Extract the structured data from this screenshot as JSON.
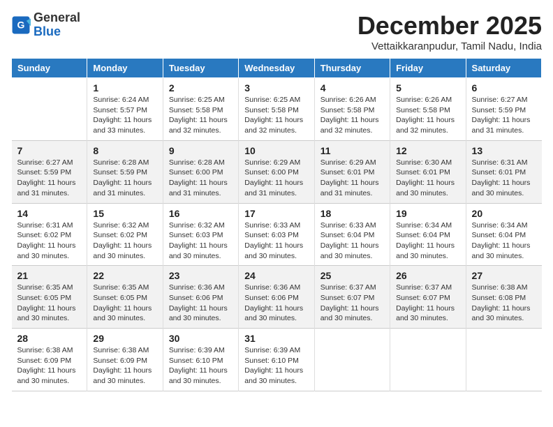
{
  "logo": {
    "general": "General",
    "blue": "Blue"
  },
  "header": {
    "month": "December 2025",
    "location": "Vettaikkaranpudur, Tamil Nadu, India"
  },
  "days_of_week": [
    "Sunday",
    "Monday",
    "Tuesday",
    "Wednesday",
    "Thursday",
    "Friday",
    "Saturday"
  ],
  "weeks": [
    [
      {
        "day": "",
        "info": ""
      },
      {
        "day": "1",
        "info": "Sunrise: 6:24 AM\nSunset: 5:57 PM\nDaylight: 11 hours\nand 33 minutes."
      },
      {
        "day": "2",
        "info": "Sunrise: 6:25 AM\nSunset: 5:58 PM\nDaylight: 11 hours\nand 32 minutes."
      },
      {
        "day": "3",
        "info": "Sunrise: 6:25 AM\nSunset: 5:58 PM\nDaylight: 11 hours\nand 32 minutes."
      },
      {
        "day": "4",
        "info": "Sunrise: 6:26 AM\nSunset: 5:58 PM\nDaylight: 11 hours\nand 32 minutes."
      },
      {
        "day": "5",
        "info": "Sunrise: 6:26 AM\nSunset: 5:58 PM\nDaylight: 11 hours\nand 32 minutes."
      },
      {
        "day": "6",
        "info": "Sunrise: 6:27 AM\nSunset: 5:59 PM\nDaylight: 11 hours\nand 31 minutes."
      }
    ],
    [
      {
        "day": "7",
        "info": "Sunrise: 6:27 AM\nSunset: 5:59 PM\nDaylight: 11 hours\nand 31 minutes."
      },
      {
        "day": "8",
        "info": "Sunrise: 6:28 AM\nSunset: 5:59 PM\nDaylight: 11 hours\nand 31 minutes."
      },
      {
        "day": "9",
        "info": "Sunrise: 6:28 AM\nSunset: 6:00 PM\nDaylight: 11 hours\nand 31 minutes."
      },
      {
        "day": "10",
        "info": "Sunrise: 6:29 AM\nSunset: 6:00 PM\nDaylight: 11 hours\nand 31 minutes."
      },
      {
        "day": "11",
        "info": "Sunrise: 6:29 AM\nSunset: 6:01 PM\nDaylight: 11 hours\nand 31 minutes."
      },
      {
        "day": "12",
        "info": "Sunrise: 6:30 AM\nSunset: 6:01 PM\nDaylight: 11 hours\nand 30 minutes."
      },
      {
        "day": "13",
        "info": "Sunrise: 6:31 AM\nSunset: 6:01 PM\nDaylight: 11 hours\nand 30 minutes."
      }
    ],
    [
      {
        "day": "14",
        "info": "Sunrise: 6:31 AM\nSunset: 6:02 PM\nDaylight: 11 hours\nand 30 minutes."
      },
      {
        "day": "15",
        "info": "Sunrise: 6:32 AM\nSunset: 6:02 PM\nDaylight: 11 hours\nand 30 minutes."
      },
      {
        "day": "16",
        "info": "Sunrise: 6:32 AM\nSunset: 6:03 PM\nDaylight: 11 hours\nand 30 minutes."
      },
      {
        "day": "17",
        "info": "Sunrise: 6:33 AM\nSunset: 6:03 PM\nDaylight: 11 hours\nand 30 minutes."
      },
      {
        "day": "18",
        "info": "Sunrise: 6:33 AM\nSunset: 6:04 PM\nDaylight: 11 hours\nand 30 minutes."
      },
      {
        "day": "19",
        "info": "Sunrise: 6:34 AM\nSunset: 6:04 PM\nDaylight: 11 hours\nand 30 minutes."
      },
      {
        "day": "20",
        "info": "Sunrise: 6:34 AM\nSunset: 6:04 PM\nDaylight: 11 hours\nand 30 minutes."
      }
    ],
    [
      {
        "day": "21",
        "info": "Sunrise: 6:35 AM\nSunset: 6:05 PM\nDaylight: 11 hours\nand 30 minutes."
      },
      {
        "day": "22",
        "info": "Sunrise: 6:35 AM\nSunset: 6:05 PM\nDaylight: 11 hours\nand 30 minutes."
      },
      {
        "day": "23",
        "info": "Sunrise: 6:36 AM\nSunset: 6:06 PM\nDaylight: 11 hours\nand 30 minutes."
      },
      {
        "day": "24",
        "info": "Sunrise: 6:36 AM\nSunset: 6:06 PM\nDaylight: 11 hours\nand 30 minutes."
      },
      {
        "day": "25",
        "info": "Sunrise: 6:37 AM\nSunset: 6:07 PM\nDaylight: 11 hours\nand 30 minutes."
      },
      {
        "day": "26",
        "info": "Sunrise: 6:37 AM\nSunset: 6:07 PM\nDaylight: 11 hours\nand 30 minutes."
      },
      {
        "day": "27",
        "info": "Sunrise: 6:38 AM\nSunset: 6:08 PM\nDaylight: 11 hours\nand 30 minutes."
      }
    ],
    [
      {
        "day": "28",
        "info": "Sunrise: 6:38 AM\nSunset: 6:09 PM\nDaylight: 11 hours\nand 30 minutes."
      },
      {
        "day": "29",
        "info": "Sunrise: 6:38 AM\nSunset: 6:09 PM\nDaylight: 11 hours\nand 30 minutes."
      },
      {
        "day": "30",
        "info": "Sunrise: 6:39 AM\nSunset: 6:10 PM\nDaylight: 11 hours\nand 30 minutes."
      },
      {
        "day": "31",
        "info": "Sunrise: 6:39 AM\nSunset: 6:10 PM\nDaylight: 11 hours\nand 30 minutes."
      },
      {
        "day": "",
        "info": ""
      },
      {
        "day": "",
        "info": ""
      },
      {
        "day": "",
        "info": ""
      }
    ]
  ]
}
